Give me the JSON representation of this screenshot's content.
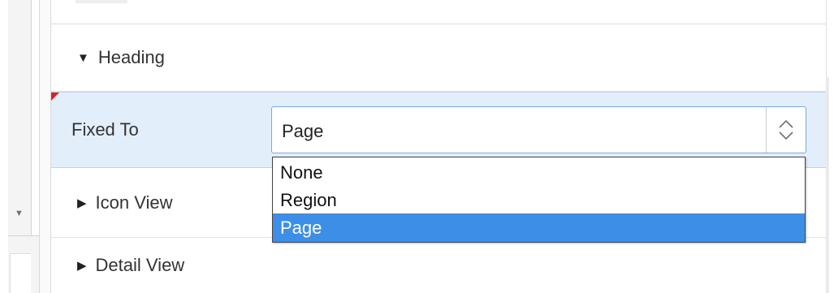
{
  "sections": {
    "heading": {
      "label": "Heading",
      "expanded": true
    },
    "icon_view": {
      "label": "Icon View",
      "expanded": false
    },
    "detail_view": {
      "label": "Detail View",
      "expanded": false
    }
  },
  "fixed_to": {
    "label": "Fixed To",
    "value": "Page",
    "options": [
      "None",
      "Region",
      "Page"
    ],
    "selected_index": 2
  },
  "colors": {
    "selected_row_bg": "#e3eefb",
    "highlight_option_bg": "#3d8ee6",
    "changed_marker": "#e02020"
  }
}
